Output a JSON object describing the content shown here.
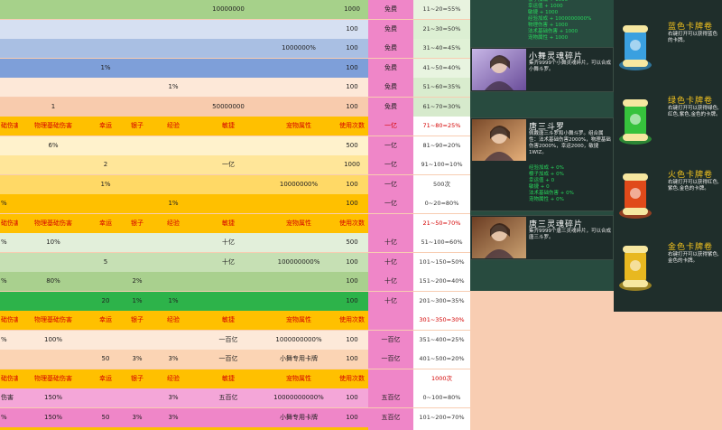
{
  "sheet": {
    "rows": [
      {
        "kind": "data",
        "bg": "#a6d18a",
        "cells": [
          "",
          "",
          "",
          "",
          "",
          "10000000",
          "",
          "1000",
          "免费",
          "11~20=55%"
        ]
      },
      {
        "kind": "data",
        "bg": "#d6e0f2",
        "cells": [
          "",
          "",
          "",
          "",
          "",
          "",
          "",
          "100",
          "免费",
          "21~30=50%"
        ]
      },
      {
        "kind": "data",
        "bg": "#a9bfe3",
        "cells": [
          "",
          "",
          "",
          "",
          "",
          "",
          "1000000%",
          "100",
          "免费",
          "31~40=45%"
        ]
      },
      {
        "kind": "data",
        "bg": "#7e9fd9",
        "cells": [
          "",
          "",
          "1%",
          "",
          "",
          "",
          "",
          "100",
          "免费",
          "41~50=40%"
        ]
      },
      {
        "kind": "data",
        "bg": "#fde8d8",
        "cells": [
          "",
          "",
          "",
          "",
          "1%",
          "",
          "",
          "100",
          "免费",
          "51~60=35%"
        ]
      },
      {
        "kind": "data",
        "bg": "#f8cbad",
        "cells": [
          "",
          "1",
          "",
          "",
          "",
          "50000000",
          "",
          "100",
          "免费",
          "61~70=30%"
        ]
      },
      {
        "kind": "header",
        "bg": "#ffc000",
        "cells": [
          "础伤害",
          "物理基础伤害",
          "幸运",
          "银子",
          "经验",
          "敏捷",
          "宠物属性",
          "使用次数",
          "一亿",
          "71~80=25%"
        ]
      },
      {
        "kind": "data",
        "bg": "#fff2cc",
        "cells": [
          "",
          "6%",
          "",
          "",
          "",
          "",
          "",
          "500",
          "一亿",
          "81~90=20%"
        ]
      },
      {
        "kind": "data",
        "bg": "#ffe699",
        "cells": [
          "",
          "",
          "2",
          "",
          "",
          "一亿",
          "",
          "1000",
          "一亿",
          "91~100=10%"
        ]
      },
      {
        "kind": "data",
        "bg": "#ffd966",
        "cells": [
          "",
          "",
          "1%",
          "",
          "",
          "",
          "10000000%",
          "100",
          "一亿",
          "500次"
        ]
      },
      {
        "kind": "data",
        "bg": "#ffc000",
        "cells": [
          "%",
          "",
          "",
          "",
          "1%",
          "",
          "",
          "100",
          "一亿",
          "0~20=80%"
        ]
      },
      {
        "kind": "header",
        "bg": "#ffc000",
        "cells": [
          "础伤害",
          "物理基础伤害",
          "幸运",
          "银子",
          "经验",
          "敏捷",
          "宠物属性",
          "使用次数",
          "",
          "21~50=70%"
        ]
      },
      {
        "kind": "data",
        "bg": "#e2efda",
        "cells": [
          "%",
          "10%",
          "",
          "",
          "",
          "十亿",
          "",
          "500",
          "十亿",
          "51~100=60%"
        ]
      },
      {
        "kind": "data",
        "bg": "#c6e0b4",
        "cells": [
          "",
          "",
          "5",
          "",
          "",
          "十亿",
          "100000000%",
          "100",
          "十亿",
          "101~150=50%"
        ]
      },
      {
        "kind": "data",
        "bg": "#a9d08e",
        "cells": [
          "%",
          "80%",
          "",
          "2%",
          "",
          "",
          "",
          "100",
          "十亿",
          "151~200=40%"
        ]
      },
      {
        "kind": "data",
        "bg": "#2db34a",
        "cells": [
          "",
          "",
          "20",
          "1%",
          "1%",
          "",
          "",
          "100",
          "十亿",
          "201~300=35%"
        ]
      },
      {
        "kind": "header",
        "bg": "#ffc000",
        "cells": [
          "础伤害",
          "物理基础伤害",
          "幸运",
          "银子",
          "经验",
          "敏捷",
          "宠物属性",
          "使用次数",
          "",
          "301~350=30%"
        ]
      },
      {
        "kind": "data",
        "bg": "#fde9d9",
        "cells": [
          "%",
          "100%",
          "",
          "",
          "",
          "一百亿",
          "1000000000%",
          "100",
          "一百亿",
          "351~400=25%"
        ]
      },
      {
        "kind": "data",
        "bg": "#fbd4b4",
        "cells": [
          "",
          "",
          "50",
          "3%",
          "3%",
          "一百亿",
          "小舞专用卡牌",
          "100",
          "一百亿",
          "401~500=20%"
        ]
      },
      {
        "kind": "header",
        "bg": "#ffc000",
        "cells": [
          "础伤害",
          "物理基础伤害",
          "幸运",
          "银子",
          "经验",
          "敏捷",
          "宠物属性",
          "使用次数",
          "",
          "1000次"
        ]
      },
      {
        "kind": "data",
        "bg": "#f4a6d8",
        "cells": [
          "伤害",
          "150%",
          "",
          "",
          "3%",
          "五百亿",
          "10000000000%",
          "100",
          "五百亿",
          "0~100=80%"
        ]
      },
      {
        "kind": "data",
        "bg": "#ef86c8",
        "cells": [
          "%",
          "150%",
          "50",
          "3%",
          "3%",
          "",
          "小舞专用卡牌",
          "100",
          "五百亿",
          "101~200=70%"
        ]
      },
      {
        "kind": "data",
        "bg": "#ffc000",
        "cells": [
          "",
          "",
          "",
          "",
          "",
          "",
          "",
          "",
          "",
          ""
        ]
      }
    ],
    "col_bgs": [
      "#e8f3df",
      "#dcefd3",
      "#e0f1d6",
      "#e8f4e0",
      "#d9ecce",
      "#d6eacc",
      "#ffffff",
      "#ffffff",
      "#ffffff",
      "#ffffff",
      "#ffffff",
      "#ffffff",
      "#ffffff",
      "#ffffff",
      "#ffffff",
      "#ffffff",
      "#ffffff",
      "#ffffff",
      "#ffffff",
      "#ffffff",
      "#ffffff",
      "#ffffff",
      "#ffffff"
    ]
  },
  "panel": {
    "top_stats": [
      "樱子加成 + 1000",
      "幸运值 + 1000",
      "敏捷 + 1000",
      "经验加成 + 1000000000%",
      "物理伤害 + 1000",
      "法术基础伤害 + 1000",
      "宠物属性 + 1000"
    ],
    "cards": [
      {
        "title": "小舞灵魂碎片",
        "text": "集齐9999个小舞灵魂碎片，可以合成小舞斗罗。",
        "stats": []
      },
      {
        "title": "唐三斗罗",
        "text": "佩戴唐三斗罗和小舞斗罗。组合属性：法术基础伤害2000%，物理基础伤害2000%，幸运2000，敏捷1WIZ。",
        "stats": [
          "经验加成 + 0%",
          "樱子加成 + 0%",
          "幸运值 + 0",
          "敏捷 + 0",
          "法术基础伤害 + 0%",
          "宠物属性 + 0%"
        ]
      },
      {
        "title": "唐三灵魂碎片",
        "text": "集齐9999个唐三灵魂碎片，可以合成唐三斗罗。",
        "stats": []
      }
    ],
    "colors": {
      "stat_green": "#28d65c",
      "title": "#ffffff"
    }
  },
  "right": {
    "items": [
      {
        "title": "蓝色卡牌卷",
        "text": "右键打开可以获得蓝色的卡牌。",
        "color": "#3aa0e0"
      },
      {
        "title": "绿色卡牌卷",
        "text": "右键打开可以获得绿色,红色,紫色,金色的卡牌。",
        "color": "#36c23c"
      },
      {
        "title": "火色卡牌卷",
        "text": "右键打开可以获得红色,紫色,金色的卡牌。",
        "color": "#e04a1a"
      },
      {
        "title": "金色卡牌卷",
        "text": "右键打开可以获得紫色,金色的卡牌。",
        "color": "#e8b820"
      }
    ],
    "title_color": "#f2c21f"
  }
}
